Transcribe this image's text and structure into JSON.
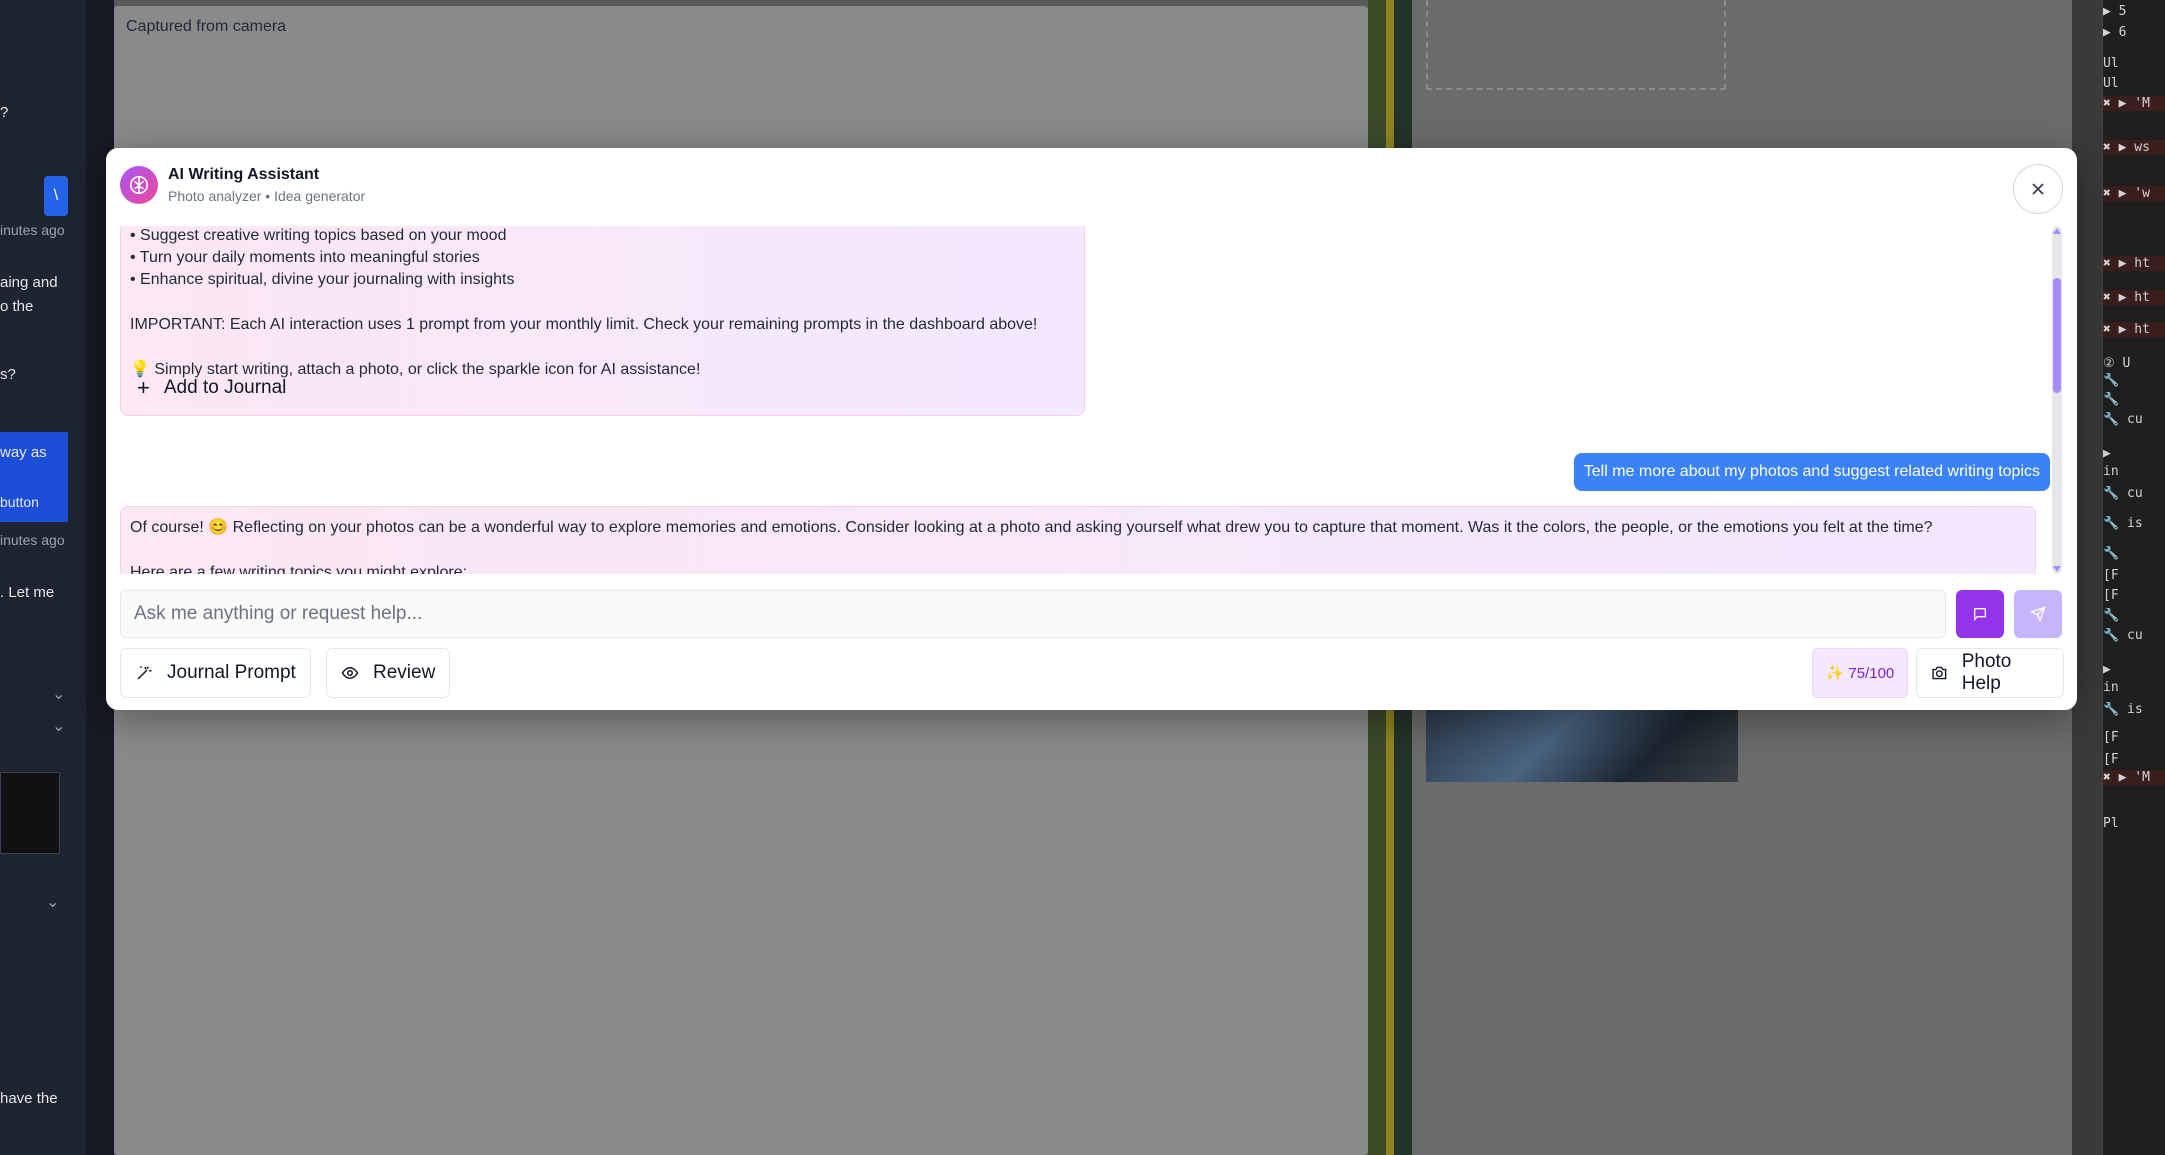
{
  "background": {
    "sidebar_fragments": [
      "?",
      "\\",
      "inutes ago",
      "aing and",
      "o the",
      "s?",
      "way as",
      "button",
      "inutes ago",
      ". Let me",
      "have the"
    ],
    "camera_label": "Captured from camera"
  },
  "console": {
    "lines": [
      {
        "text": "▶ 5",
        "kind": "badge"
      },
      {
        "text": "▶ 6",
        "kind": "badge"
      },
      {
        "text": "Ul",
        "kind": "plain"
      },
      {
        "text": "Ul",
        "kind": "plain"
      },
      {
        "text": "✖ ▶ 'M",
        "kind": "err"
      },
      {
        "text": "✖ ▶ ws",
        "kind": "err"
      },
      {
        "text": "✖ ▶ 'w",
        "kind": "err"
      },
      {
        "text": "✖ ▶ ht",
        "kind": "err"
      },
      {
        "text": "✖ ▶ ht",
        "kind": "err"
      },
      {
        "text": "✖ ▶ ht",
        "kind": "err"
      },
      {
        "text": "② U",
        "kind": "plain"
      },
      {
        "text": "  🔧",
        "kind": "plain"
      },
      {
        "text": "  🔧",
        "kind": "plain"
      },
      {
        "text": "  🔧 cu",
        "kind": "plain"
      },
      {
        "text": "   ▶",
        "kind": "plain"
      },
      {
        "text": "  in",
        "kind": "plain"
      },
      {
        "text": "  🔧 cu",
        "kind": "plain"
      },
      {
        "text": "  🔧 is",
        "kind": "plain"
      },
      {
        "text": "  🔧",
        "kind": "plain"
      },
      {
        "text": "  [F",
        "kind": "plain"
      },
      {
        "text": "  [F",
        "kind": "plain"
      },
      {
        "text": "  🔧",
        "kind": "plain"
      },
      {
        "text": "  🔧 cu",
        "kind": "plain"
      },
      {
        "text": "   ▶",
        "kind": "plain"
      },
      {
        "text": "  in",
        "kind": "plain"
      },
      {
        "text": "  🔧 is",
        "kind": "plain"
      },
      {
        "text": "  [F",
        "kind": "plain"
      },
      {
        "text": "  [F",
        "kind": "plain"
      },
      {
        "text": "✖ ▶ 'M",
        "kind": "err"
      },
      {
        "text": "  Pl",
        "kind": "plain"
      }
    ]
  },
  "modal": {
    "title": "AI Writing Assistant",
    "subtitle": "Photo analyzer • Idea generator",
    "close_label": "×"
  },
  "messages": {
    "first_ai": {
      "lines": [
        "• Suggest creative writing topics based on your mood",
        "• Turn your daily moments into meaningful stories",
        "• Enhance spiritual, divine your journaling with insights"
      ],
      "important": "IMPORTANT: Each AI interaction uses 1 prompt from your monthly limit. Check your remaining prompts in the dashboard above!",
      "tip": "💡 Simply start writing, attach a photo, or click the sparkle icon for AI assistance!",
      "add_label": "Add to Journal"
    },
    "user": "Tell me more about my photos and suggest related writing topics",
    "second_ai": {
      "line1": "Of course! 😊 Reflecting on your photos can be a wonderful way to explore memories and emotions. Consider looking at a photo and asking yourself what drew you to capture that moment. Was it the colors, the people, or the emotions you felt at the time?",
      "line2": "Here are a few writing topics you might explore:"
    }
  },
  "input": {
    "placeholder": "Ask me anything or request help..."
  },
  "toolbar": {
    "journal_prompt": "Journal Prompt",
    "review": "Review",
    "quota": "75/100",
    "photo_help": "Photo Help"
  },
  "colors": {
    "accent": "#9333ea",
    "user_bubble": "#3b82f6",
    "send_disabled": "#c4b5fd"
  }
}
